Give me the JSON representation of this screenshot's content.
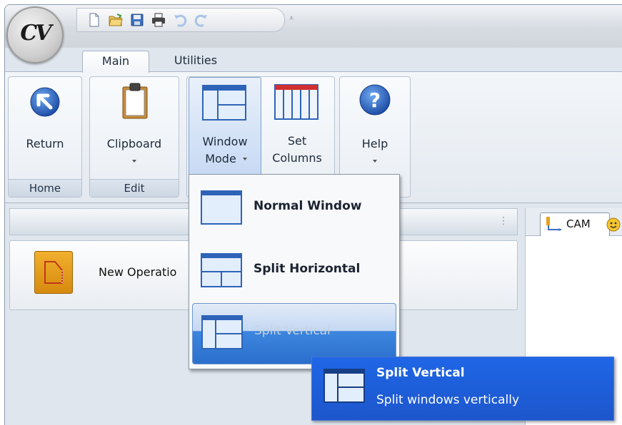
{
  "app": {
    "logo_text": "CV"
  },
  "quick_access": {
    "icons": [
      "new-file-icon",
      "open-folder-icon",
      "save-icon",
      "print-icon",
      "undo-icon",
      "redo-icon"
    ],
    "customize_glyph": "⩡"
  },
  "tabs": [
    {
      "label": "Main",
      "active": true
    },
    {
      "label": "Utilities",
      "active": false
    }
  ],
  "ribbon": {
    "groups": [
      {
        "label": "Home",
        "buttons": [
          {
            "label": "Return",
            "icon": "return-arrow-icon"
          }
        ]
      },
      {
        "label": "Edit",
        "buttons": [
          {
            "label": "Clipboard",
            "icon": "clipboard-icon",
            "dropdown": true
          }
        ]
      },
      {
        "label": "",
        "buttons": [
          {
            "label_line1": "Window",
            "label_line2": "Mode",
            "icon": "window-mode-icon",
            "dropdown": true,
            "active": true
          },
          {
            "label_line1": "Set",
            "label_line2": "Columns",
            "icon": "columns-icon"
          }
        ]
      },
      {
        "label": "",
        "buttons": [
          {
            "label": "Help",
            "icon": "help-icon",
            "dropdown": true
          }
        ]
      }
    ]
  },
  "panel": {
    "grip": "⋮",
    "operation": {
      "label": "New Operatio",
      "icon": "new-operation-icon"
    }
  },
  "right_pane": {
    "tab_label": "CAM"
  },
  "window_mode_menu": {
    "items": [
      {
        "label": "Normal Window",
        "icon": "normal-window-icon"
      },
      {
        "label": "Split Horizontal",
        "icon": "split-horizontal-icon"
      },
      {
        "label": "Split Vertical",
        "icon": "split-vertical-icon",
        "highlighted": true
      }
    ]
  },
  "tooltip": {
    "title": "Split Vertical",
    "description": "Split windows vertically"
  },
  "colors": {
    "accent_blue": "#2a6fcc",
    "tooltip_blue": "#1f66e6",
    "ribbon_bg": "#e3e9f0",
    "operation_orange": "#e39a1b"
  }
}
